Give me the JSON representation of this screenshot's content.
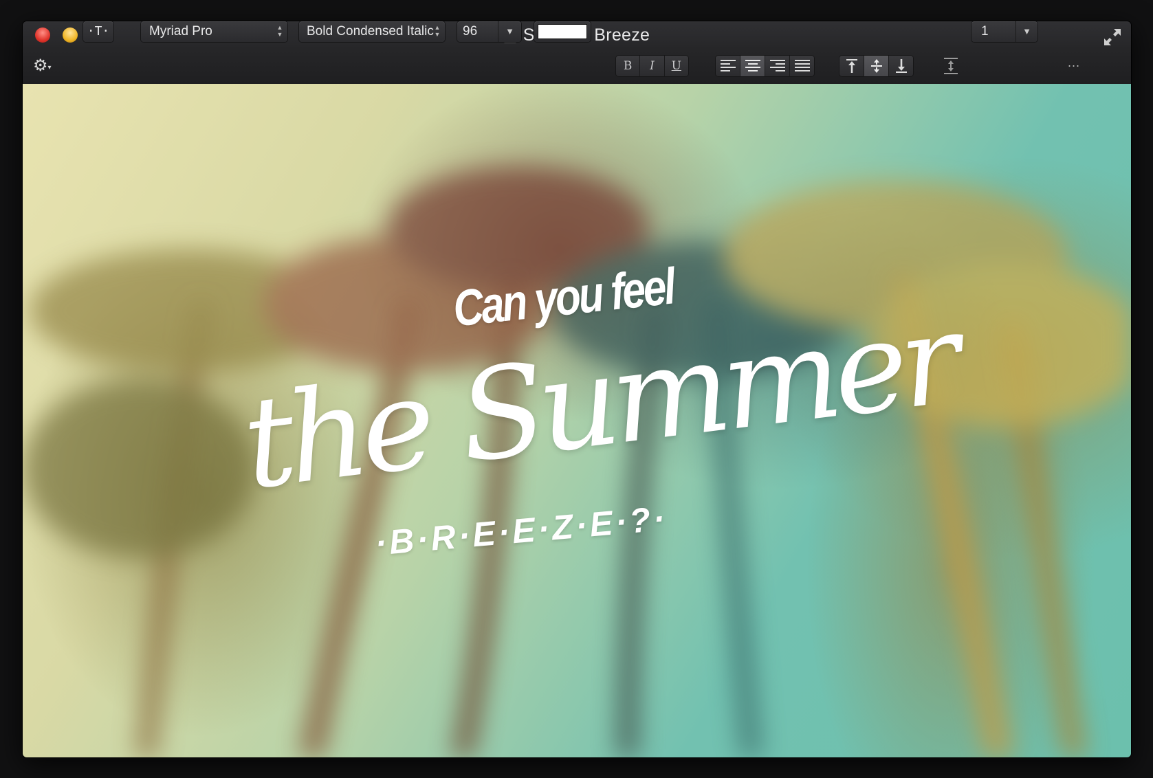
{
  "window": {
    "title": "Summer Breeze"
  },
  "toolbar": {
    "gear_menu": "⚙",
    "text_tool_label": "·T·",
    "font_family": "Myriad Pro",
    "font_style": "Bold Condensed Italic",
    "font_size": "96",
    "text_color": "#ffffff",
    "bold_label": "B",
    "italic_label": "I",
    "underline_label": "U",
    "line_spacing": "1",
    "more_label": "..."
  },
  "canvas": {
    "line1": "Can you feel",
    "line2": "the Summer",
    "line3": "·B·R·E·E·Z·E·?·"
  }
}
